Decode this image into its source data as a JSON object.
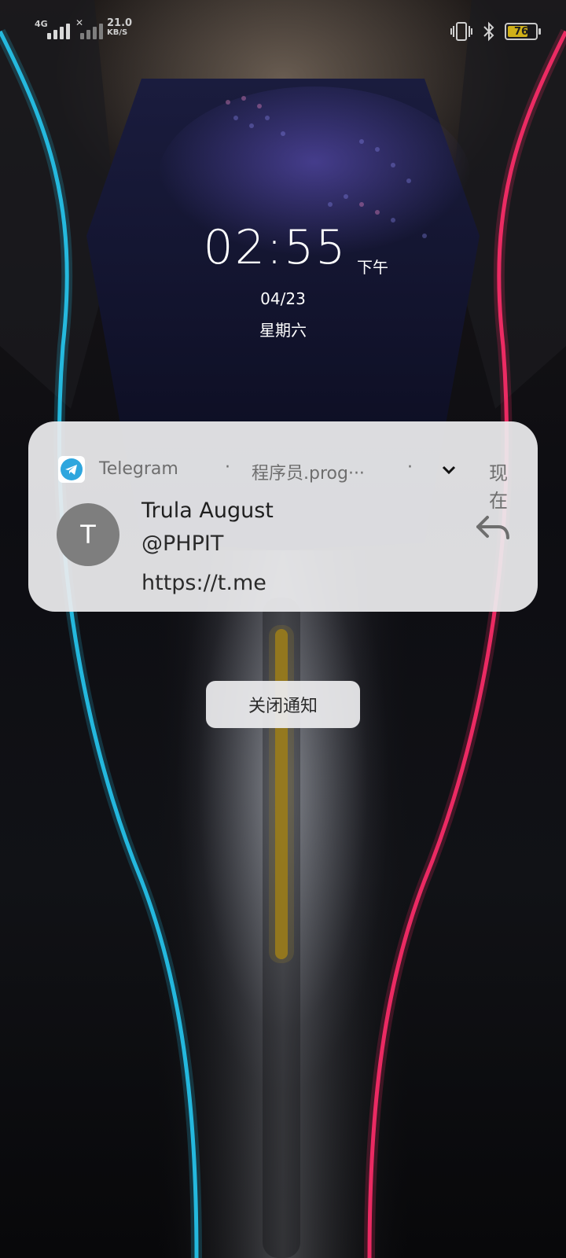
{
  "status_bar": {
    "network_type": "4G",
    "speed_value": "21.0",
    "speed_unit": "KB/S",
    "battery_level": 76,
    "battery_label": "76",
    "battery_color": "#d0b018",
    "icons": [
      "signal-4g-icon",
      "signal-no-service-icon",
      "vibrate-icon",
      "bluetooth-icon",
      "battery-icon"
    ]
  },
  "lockscreen": {
    "time": "02:55",
    "ampm": "下午",
    "date": "04/23",
    "weekday": "星期六"
  },
  "notification": {
    "app_icon": "telegram-icon",
    "app_name": "Telegram",
    "separator": "·",
    "channel": "程序员.prog···",
    "expand_icon": "chevron-down-icon",
    "timestamp": "现在",
    "avatar_letter": "T",
    "sender": "Trula August",
    "message_line1": "@PHPIT",
    "message_line2": "https://t.me",
    "reply_icon": "reply-icon",
    "accent_color": "#2ea6de"
  },
  "actions": {
    "dismiss_label": "关闭通知"
  }
}
